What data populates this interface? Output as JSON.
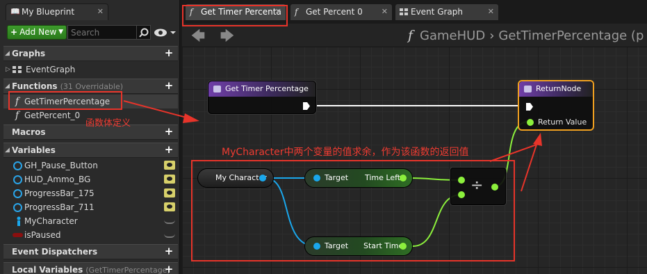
{
  "tabs": {
    "blueprint": "My Blueprint",
    "get_timer": "Get Timer Percenta",
    "get_percent": "Get Percent 0",
    "event_graph": "Event Graph"
  },
  "toolbar": {
    "add_new": "Add New",
    "search_placeholder": "Search"
  },
  "sections": {
    "graphs": "Graphs",
    "functions": "Functions",
    "functions_sub": "(31 Overridable)",
    "macros": "Macros",
    "variables": "Variables",
    "event_dispatchers": "Event Dispatchers",
    "local_variables": "Local Variables",
    "local_variables_sub": "(GetTimerPercentage)"
  },
  "graphs_items": [
    "EventGraph"
  ],
  "functions_items": [
    "GetTimerPercentage",
    "GetPercent_0"
  ],
  "variables_items": [
    {
      "name": "GH_Pause_Button",
      "icon": "object-circle-icon",
      "visible": true
    },
    {
      "name": "HUD_Ammo_BG",
      "icon": "object-circle-icon",
      "visible": true
    },
    {
      "name": "ProgressBar_175",
      "icon": "object-circle-icon",
      "visible": true
    },
    {
      "name": "ProgressBar_711",
      "icon": "object-circle-icon",
      "visible": true
    },
    {
      "name": "MyCharacter",
      "icon": "character-icon",
      "visible": false
    },
    {
      "name": "isPaused",
      "icon": "boolean-pill-icon",
      "visible": false
    }
  ],
  "breadcrumb": {
    "parent": "GameHUD",
    "current": "GetTimerPercentage (p"
  },
  "nodes": {
    "entry": {
      "title": "Get Timer Percentage"
    },
    "return": {
      "title": "ReturnNode",
      "pin": "Return Value"
    },
    "my_character": "My Character",
    "time_left": {
      "target": "Target",
      "output": "Time Left"
    },
    "start_time": {
      "target": "Target",
      "output": "Start Time"
    },
    "divide": "÷"
  },
  "annotations": {
    "function_body": "函数体定义",
    "explanation": "MyCharacter中两个变量的值求余，作为该函数的返回值"
  },
  "colors": {
    "accent_red": "#e8342a",
    "exec": "#ffffff",
    "float_pin": "#8cf03c",
    "object_pin": "#1aa7ec",
    "function_purple": "#6f3ea8"
  }
}
